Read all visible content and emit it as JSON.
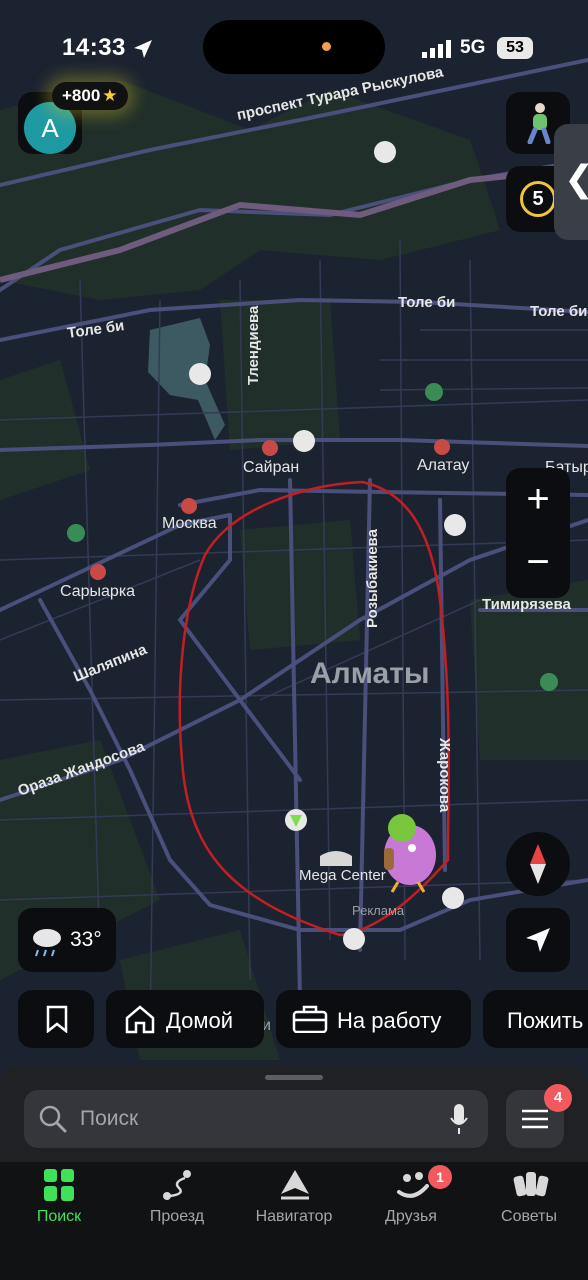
{
  "status_bar": {
    "time": "14:33",
    "network": "5G",
    "battery": "53"
  },
  "profile": {
    "avatar_letter": "A",
    "points": "+800",
    "points_star": "★"
  },
  "right_controls": {
    "route_count": "5",
    "zoom_in": "+",
    "zoom_out": "−",
    "side_tab_chevron": "❮"
  },
  "map": {
    "labels": {
      "prospekt": "проспект Турара Рыскулова",
      "tole_bi_left": "Толе би",
      "tole_bi_mid": "Толе би",
      "tole_bi_right": "Толе би",
      "tlendieva": "Тлендиева",
      "sairan": "Сайран",
      "alatau": "Алатау",
      "batyr": "Батыр",
      "moskva": "Москва",
      "saryarka": "Сарыарка",
      "rozybakieva": "Розыбакиева",
      "timiryazeva": "Тимирязева",
      "shalyapina": "Шаляпина",
      "almaty": "Алматы",
      "oraza": "Ораза Жандосова",
      "zharokova": "Жарокова",
      "mega_center": "Mega Center",
      "reklama": "Реклама",
      "partial_letter": "и"
    },
    "colors": {
      "background": "#1c2330",
      "road": "#4a4f7c",
      "route": "#c51d24"
    }
  },
  "weather": {
    "temperature": "33°",
    "icon": "cloud-rain-icon"
  },
  "quick_buttons": {
    "home": "Домой",
    "work": "На работу",
    "live": "Пожить"
  },
  "search": {
    "placeholder": "Поиск",
    "menu_badge": "4"
  },
  "tabs": [
    {
      "label": "Поиск",
      "icon": "search-tab-icon",
      "active": true
    },
    {
      "label": "Проезд",
      "icon": "route-icon",
      "active": false
    },
    {
      "label": "Навигатор",
      "icon": "navigator-icon",
      "active": false
    },
    {
      "label": "Друзья",
      "icon": "friends-icon",
      "active": false,
      "badge": "1"
    },
    {
      "label": "Советы",
      "icon": "tips-icon",
      "active": false
    }
  ],
  "accent_colors": {
    "active_tab": "#3ee157",
    "badge": "#f25a60",
    "route_ring": "#f0c53a",
    "avatar": "#1e9aa3"
  }
}
